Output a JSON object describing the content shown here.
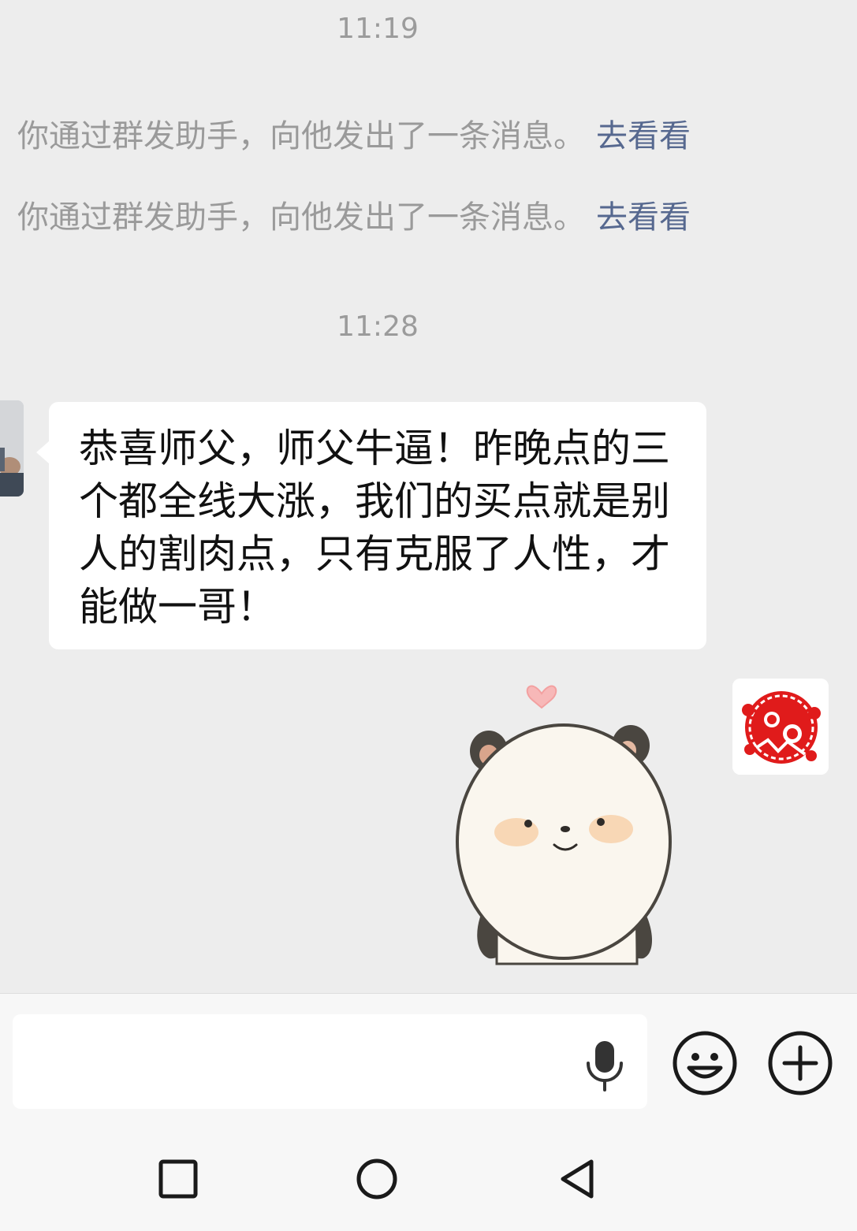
{
  "chat": {
    "timestamps": [
      "11:19",
      "11:28"
    ],
    "system_messages": [
      {
        "text": "你通过群发助手，向他发出了一条消息。",
        "link": "去看看"
      },
      {
        "text": "你通过群发助手，向他发出了一条消息。",
        "link": "去看看"
      }
    ],
    "incoming_message": {
      "text": "恭喜师父，师父牛逼！昨晚点的三个都全线大涨，我们的买点就是别人的割肉点，只有克服了人性，才能做一哥！"
    },
    "outgoing_sticker": {
      "description_icon": "panda-sticker-icon"
    }
  },
  "input_bar": {
    "placeholder": "",
    "value": "",
    "icons": [
      "microphone-icon",
      "emoji-icon",
      "plus-icon"
    ]
  },
  "nav_bar": {
    "icons": [
      "recent-apps-icon",
      "home-icon",
      "back-icon"
    ]
  },
  "colors": {
    "background": "#ededed",
    "link": "#56688f",
    "system_text": "#9a9a9a",
    "timestamp": "#9b9b9b",
    "bubble": "#ffffff"
  }
}
